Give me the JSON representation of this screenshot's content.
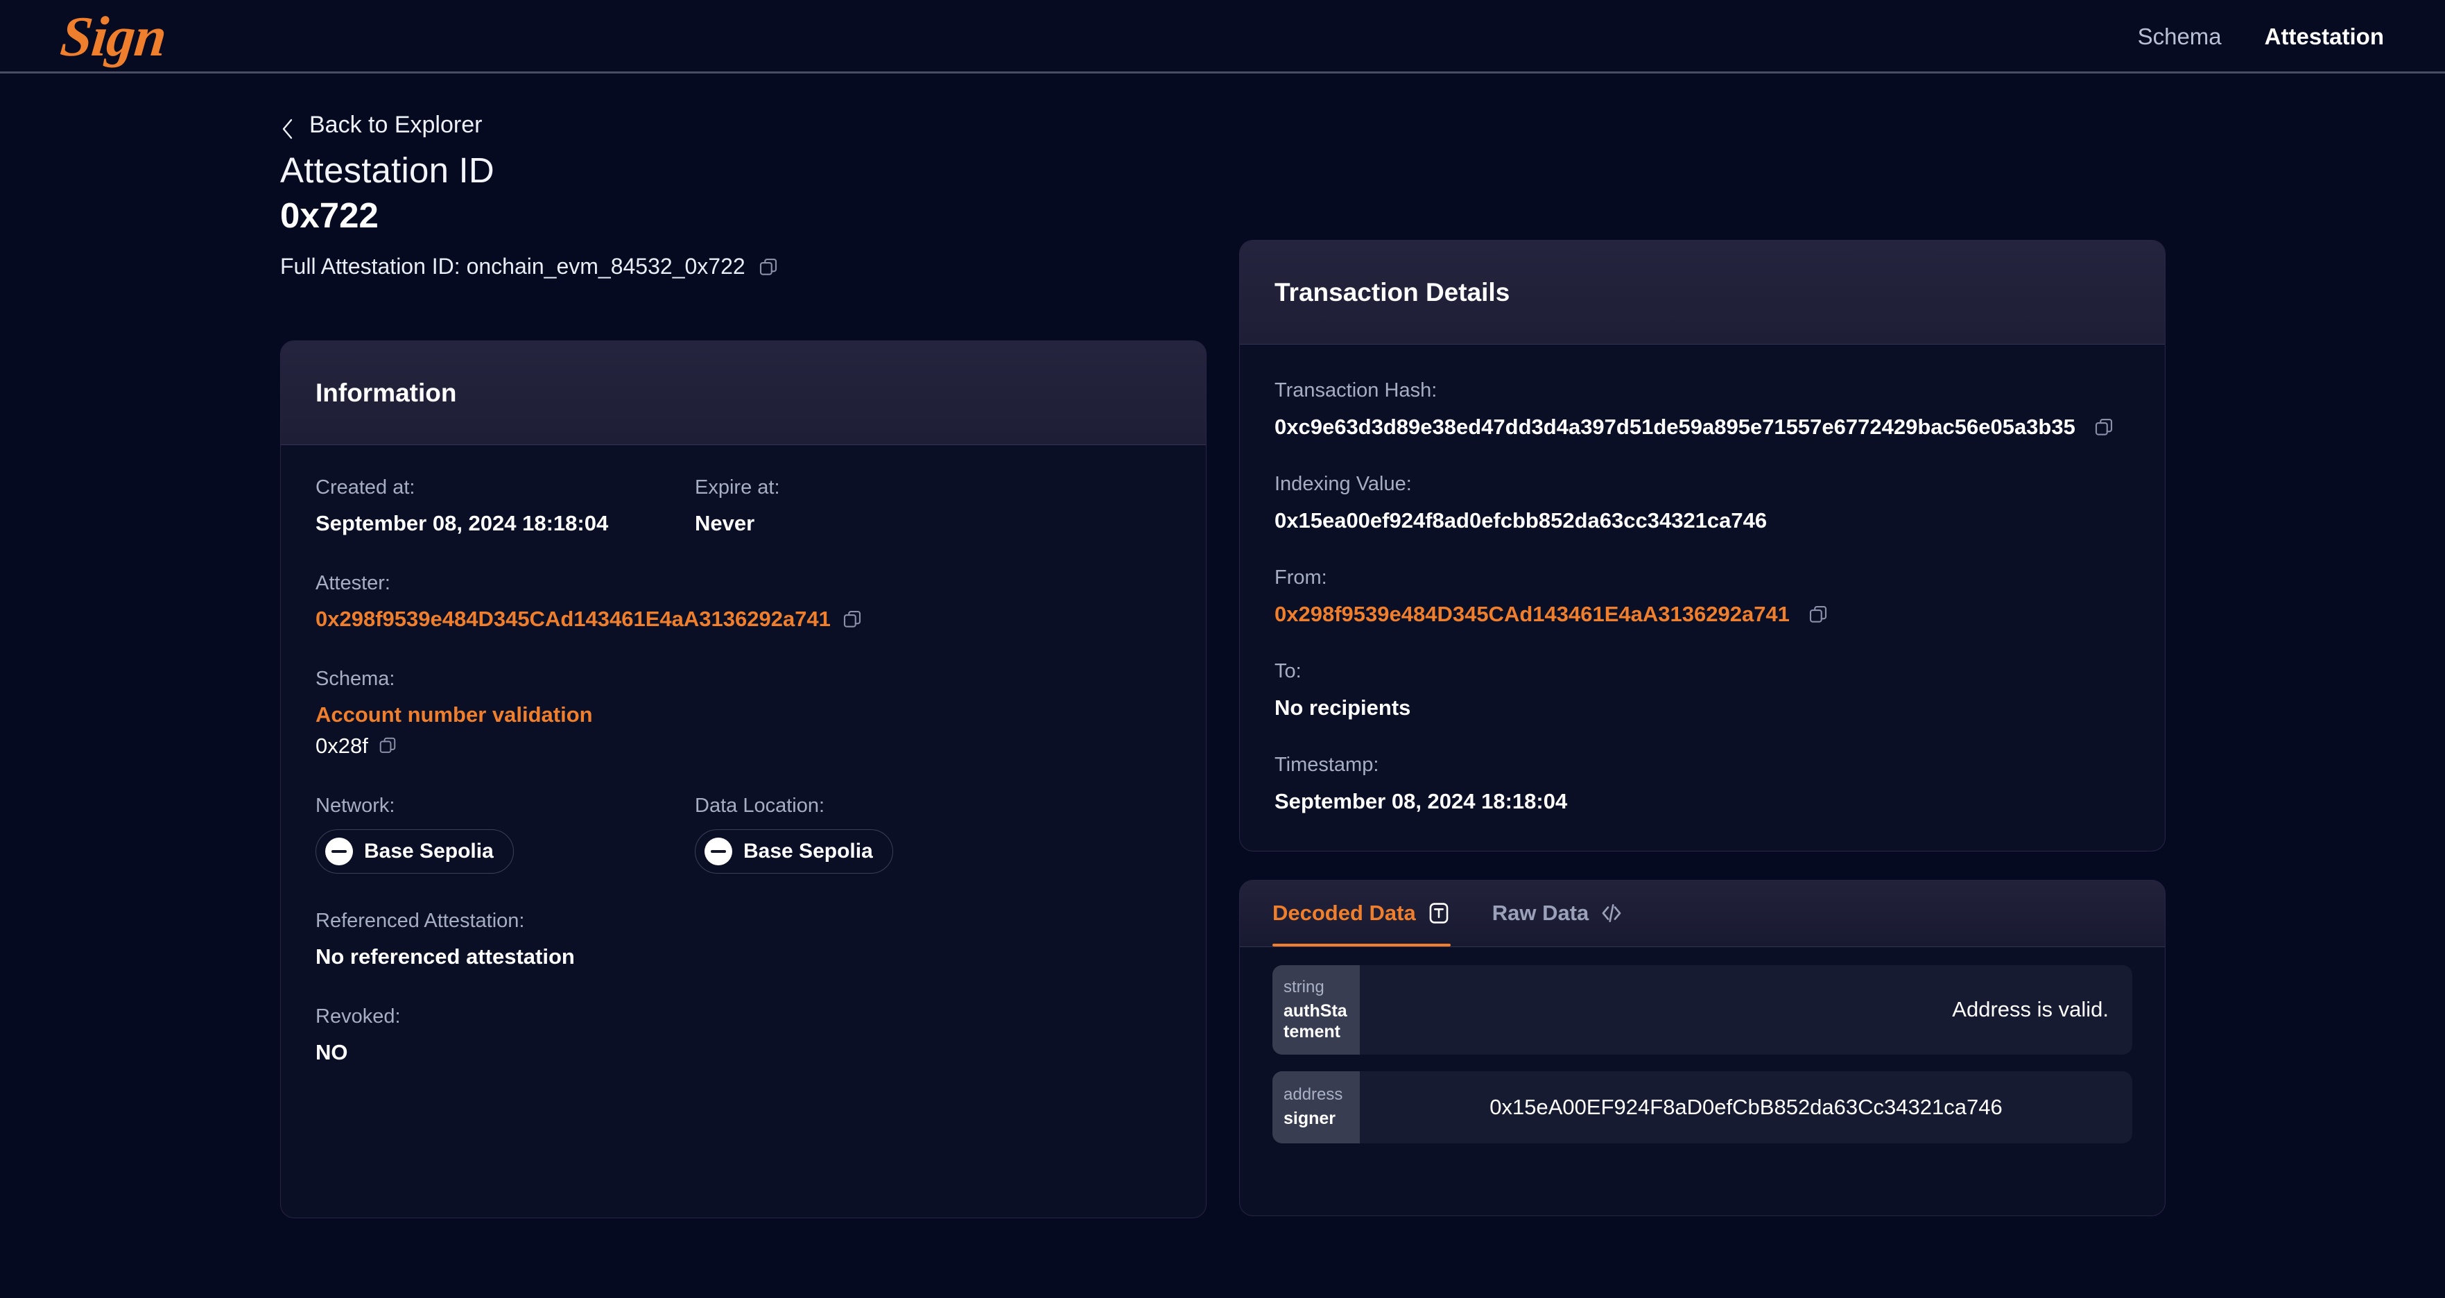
{
  "nav": {
    "logo_text": "Sign",
    "links": [
      {
        "label": "Schema",
        "active": false
      },
      {
        "label": "Attestation",
        "active": true
      }
    ]
  },
  "page": {
    "back_label": "Back to Explorer",
    "title": "Attestation ID",
    "id": "0x722",
    "full_id_label": "Full Attestation ID: onchain_evm_84532_0x722"
  },
  "information": {
    "card_title": "Information",
    "created_at_label": "Created at:",
    "created_at_value": "September 08, 2024 18:18:04",
    "expire_at_label": "Expire at:",
    "expire_at_value": "Never",
    "attester_label": "Attester:",
    "attester_value": "0x298f9539e484D345CAd143461E4aA3136292a741",
    "schema_label": "Schema:",
    "schema_name": "Account number validation",
    "schema_id": "0x28f",
    "network_label": "Network:",
    "network_value": "Base Sepolia",
    "data_location_label": "Data Location:",
    "data_location_value": "Base Sepolia",
    "referenced_label": "Referenced Attestation:",
    "referenced_value": "No referenced attestation",
    "revoked_label": "Revoked:",
    "revoked_value": "NO"
  },
  "transaction": {
    "card_title": "Transaction Details",
    "hash_label": "Transaction Hash:",
    "hash_value": "0xc9e63d3d89e38ed47dd3d4a397d51de59a895e71557e6772429bac56e05a3b35",
    "indexing_label": "Indexing Value:",
    "indexing_value": "0x15ea00ef924f8ad0efcbb852da63cc34321ca746",
    "from_label": "From:",
    "from_value": "0x298f9539e484D345CAd143461E4aA3136292a741",
    "to_label": "To:",
    "to_value": "No recipients",
    "timestamp_label": "Timestamp:",
    "timestamp_value": "September 08, 2024 18:18:04"
  },
  "data_panel": {
    "tabs": [
      {
        "label": "Decoded Data",
        "icon": "text-box-icon",
        "active": true
      },
      {
        "label": "Raw Data",
        "icon": "code-brackets-icon",
        "active": false
      }
    ],
    "rows": [
      {
        "type": "string",
        "name": "authStatement",
        "value": "Address is valid.",
        "align": "right"
      },
      {
        "type": "address",
        "name": "signer",
        "value": "0x15eA00EF924F8aD0efCbB852da63Cc34321ca746",
        "align": "center"
      }
    ]
  },
  "colors": {
    "accent_orange": "#ef7f2d",
    "page_background": "#060a20",
    "card_header": "#21213a",
    "muted_text": "#a7aec4"
  }
}
